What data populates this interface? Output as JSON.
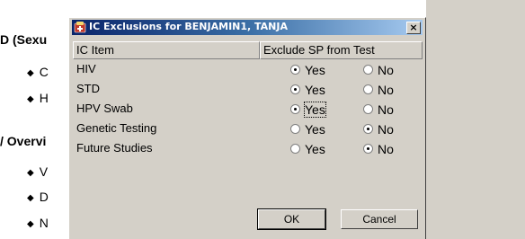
{
  "background": {
    "lines": [
      {
        "text": "D (Sexu",
        "kind": "heading"
      },
      {
        "text": "C",
        "kind": "bullet"
      },
      {
        "text": "H",
        "kind": "bullet"
      },
      {
        "text": "/ Overvi",
        "kind": "heading"
      },
      {
        "text": "V",
        "kind": "bullet"
      },
      {
        "text": "D",
        "kind": "bullet"
      },
      {
        "text": "N",
        "kind": "bullet"
      }
    ],
    "bullet_glyph": "◆"
  },
  "dialog": {
    "title": "IC Exclusions for BENJAMIN1, TANJA",
    "close_label": "×",
    "columns": {
      "item": "IC Item",
      "exclude": "Exclude SP from Test"
    },
    "option_yes": "Yes",
    "option_no": "No",
    "rows": [
      {
        "item": "HIV",
        "selected": "Yes"
      },
      {
        "item": "STD",
        "selected": "Yes"
      },
      {
        "item": "HPV Swab",
        "selected": "Yes"
      },
      {
        "item": "Genetic Testing",
        "selected": "No"
      },
      {
        "item": "Future Studies",
        "selected": "No"
      }
    ],
    "ok_label": "OK",
    "cancel_label": "Cancel",
    "colors": {
      "title_start": "#0a246a",
      "title_end": "#a6caf0",
      "face": "#d4d0c8"
    }
  }
}
